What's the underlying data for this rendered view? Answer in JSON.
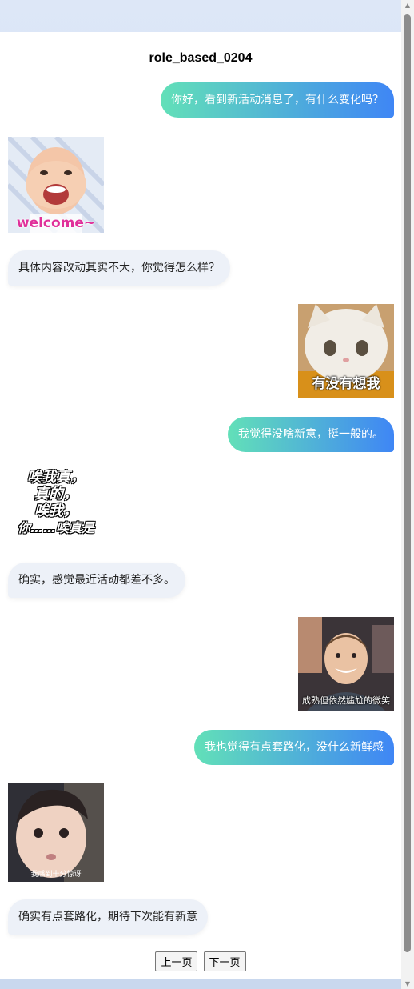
{
  "header": {
    "title": "role_based_0204"
  },
  "messages": [
    {
      "side": "me",
      "text": "你好，看到新活动消息了，有什么变化吗？"
    },
    {
      "side": "them",
      "sticker": "laughing-baby-sticker",
      "caption": "welcome~"
    },
    {
      "side": "them",
      "text": "具体内容改动其实不大，你觉得怎么样？"
    },
    {
      "side": "me",
      "sticker": "white-cat-sticker",
      "caption": "有没有想我"
    },
    {
      "side": "me",
      "text": "我觉得没啥新意，挺一般的。"
    },
    {
      "side": "them",
      "sticker": "text-sticker",
      "caption_lines": [
        "唉我真，",
        "真的，",
        "唉我，",
        "你……唉真是"
      ]
    },
    {
      "side": "them",
      "text": "确实，感觉最近活动都差不多。"
    },
    {
      "side": "me",
      "sticker": "smiling-boy-sticker",
      "caption": "成熟但依然尴尬的微笑"
    },
    {
      "side": "me",
      "text": "我也觉得有点套路化，没什么新鲜感"
    },
    {
      "side": "them",
      "sticker": "surprised-toddler-sticker",
      "caption": "我感到十分惊讶"
    },
    {
      "side": "them",
      "text": "确实有点套路化，期待下次能有新意"
    }
  ],
  "pager": {
    "prev_label": "上一页",
    "next_label": "下一页"
  },
  "colors": {
    "bubble_gradient_start": "#62e0b8",
    "bubble_gradient_end": "#3f86f5",
    "other_bubble": "#edf1f8"
  }
}
